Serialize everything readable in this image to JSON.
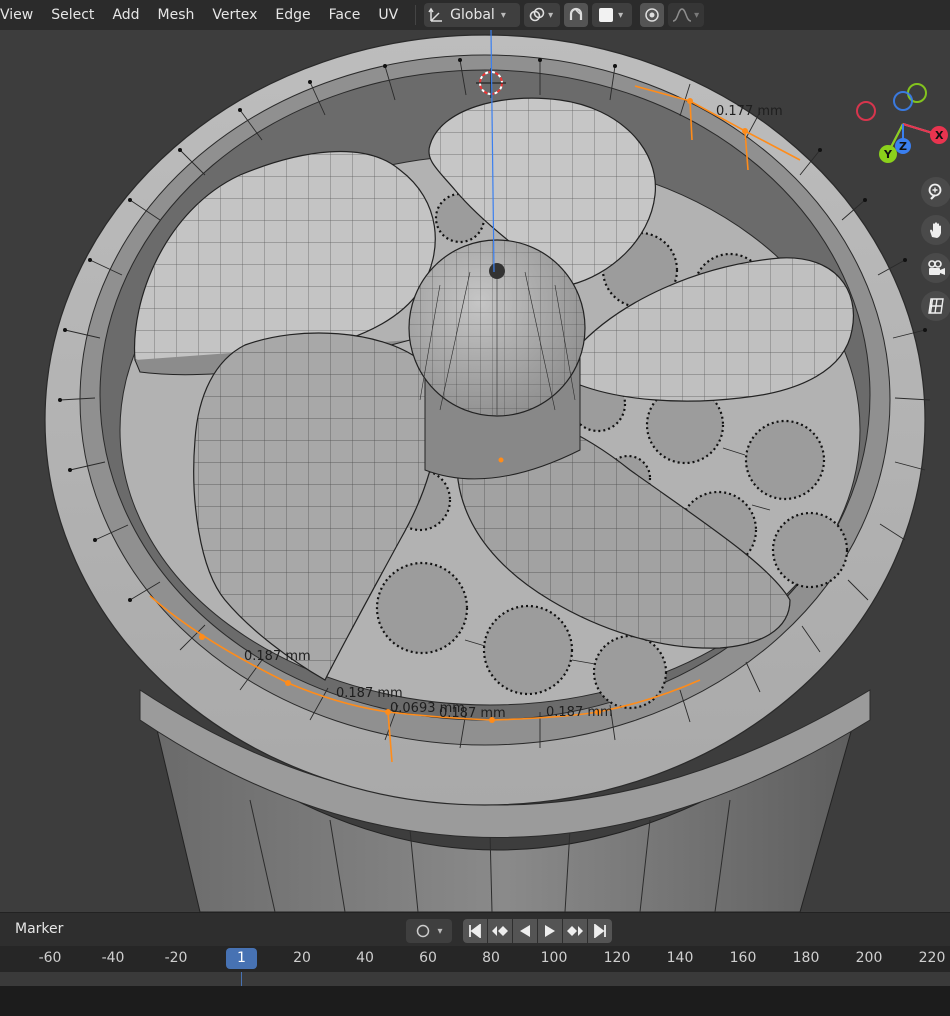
{
  "header": {
    "menu": [
      "View",
      "Select",
      "Add",
      "Mesh",
      "Vertex",
      "Edge",
      "Face",
      "UV"
    ],
    "transform_orientation": "Global"
  },
  "viewport": {
    "measurements": [
      "0.177 mm",
      "0.187 mm",
      "0.187 mm",
      "0.0693 mm",
      "0.187 mm",
      "0.187 mm"
    ],
    "gizmo_axes": [
      "X",
      "Y",
      "Z"
    ],
    "nav_icons": [
      "zoom-icon",
      "hand-pan-icon",
      "camera-icon",
      "grid-ortho-icon"
    ]
  },
  "timeline": {
    "marker_label": "Marker",
    "current_frame": "1",
    "ticks": [
      "-60",
      "-40",
      "-20",
      "20",
      "40",
      "60",
      "80",
      "100",
      "120",
      "140",
      "160",
      "180",
      "200",
      "220"
    ]
  },
  "colors": {
    "accent_blue": "#4772b3",
    "edge_select_orange": "#ff8c1a",
    "axis_x": "#e8344f",
    "axis_y": "#8bd11b",
    "axis_z": "#3a7ff0"
  }
}
